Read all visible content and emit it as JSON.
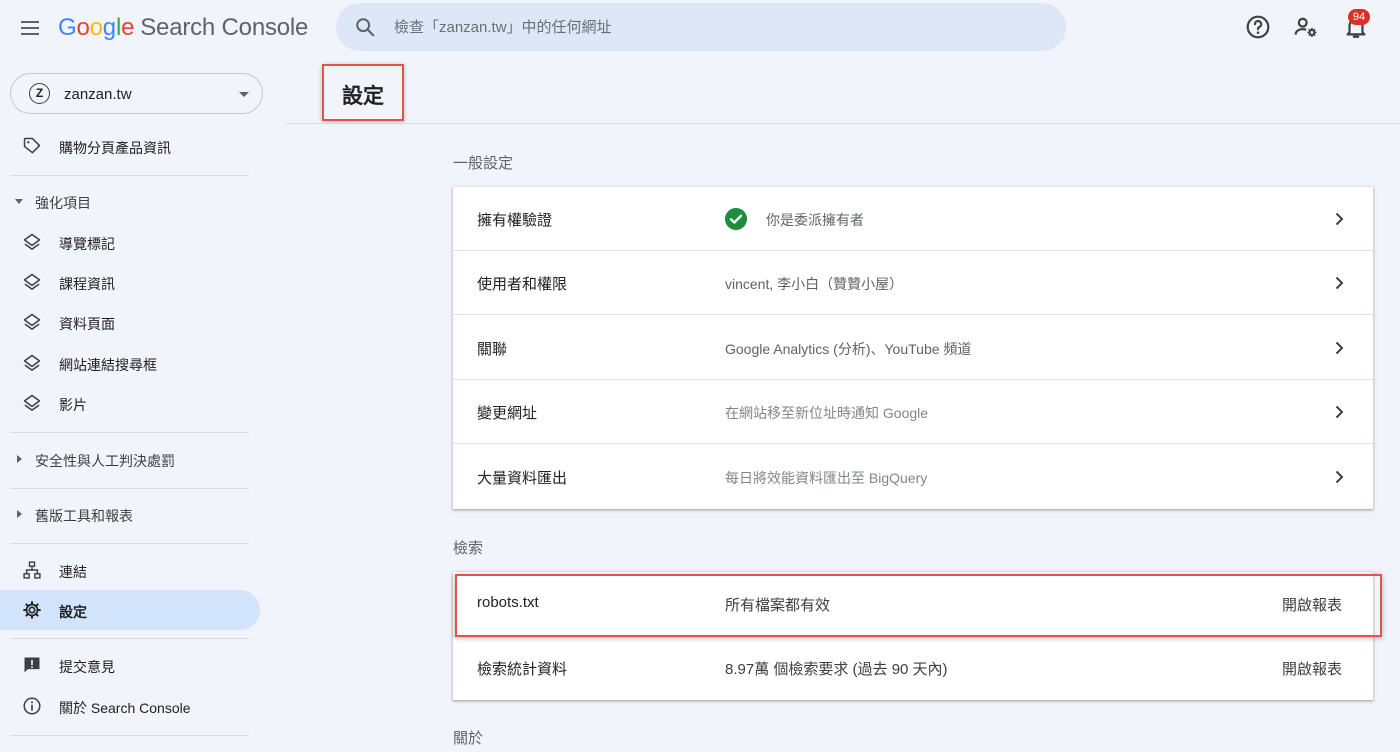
{
  "header": {
    "logo_google": [
      "G",
      "o",
      "o",
      "g",
      "l",
      "e"
    ],
    "product_name": "Search Console",
    "search_placeholder": "檢查「zanzan.tw」中的任何網址",
    "notification_count": "94"
  },
  "sidebar": {
    "property": {
      "icon_letter": "Z",
      "name": "zanzan.tw"
    },
    "shopping_item": "購物分頁產品資訊",
    "enhancements": {
      "title": "強化項目",
      "items": [
        "導覽標記",
        "課程資訊",
        "資料頁面",
        "網站連結搜尋框",
        "影片"
      ]
    },
    "security_group": "安全性與人工判決處罰",
    "legacy_group": "舊版工具和報表",
    "links": "連結",
    "settings": "設定",
    "feedback": "提交意見",
    "about": "關於 Search Console"
  },
  "main": {
    "title": "設定",
    "general": {
      "title": "一般設定",
      "rows": [
        {
          "label": "擁有權驗證",
          "value": "你是委派擁有者"
        },
        {
          "label": "使用者和權限",
          "value": "vincent, 李小白（贊贊小屋）"
        },
        {
          "label": "關聯",
          "value": "Google Analytics (分析)、YouTube 頻道"
        },
        {
          "label": "變更網址",
          "value": "在網站移至新位址時通知 Google"
        },
        {
          "label": "大量資料匯出",
          "value": "每日將效能資料匯出至 BigQuery"
        }
      ]
    },
    "crawl": {
      "title": "檢索",
      "rows": [
        {
          "label": "robots.txt",
          "value": "所有檔案都有效",
          "action": "開啟報表"
        },
        {
          "label": "檢索統計資料",
          "value": "8.97萬 個檢索要求 (過去 90 天內)",
          "action": "開啟報表"
        }
      ]
    },
    "about_title": "關於"
  },
  "colors": {
    "accent": "#1a73e8",
    "highlight": "#e0554a",
    "success": "#1e8e3e",
    "badge": "#d93025"
  }
}
